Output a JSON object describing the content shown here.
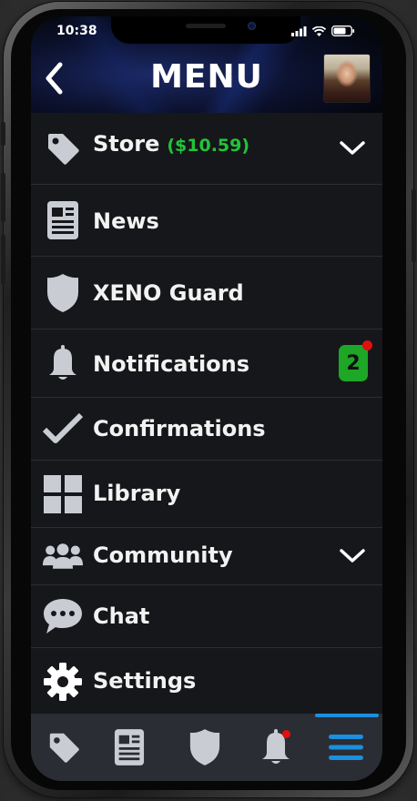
{
  "status_bar": {
    "time": "10:38"
  },
  "header": {
    "title": "MENU"
  },
  "menu": {
    "items": [
      {
        "label": "Store",
        "price": "($10.59)",
        "icon": "tag-icon",
        "expandable": true
      },
      {
        "label": "News",
        "icon": "newspaper-icon"
      },
      {
        "label": "XENO Guard",
        "icon": "shield-icon"
      },
      {
        "label": "Notifications",
        "icon": "bell-icon",
        "badge": "2"
      },
      {
        "label": "Confirmations",
        "icon": "checkmark-icon"
      },
      {
        "label": "Library",
        "icon": "grid-icon"
      },
      {
        "label": "Community",
        "icon": "people-icon",
        "expandable": true
      },
      {
        "label": "Chat",
        "icon": "chat-bubble-icon"
      },
      {
        "label": "Settings",
        "icon": "gear-icon"
      }
    ]
  },
  "tabbar": {
    "tabs": [
      {
        "name": "store",
        "icon": "tag-icon"
      },
      {
        "name": "news",
        "icon": "newspaper-icon"
      },
      {
        "name": "guard",
        "icon": "shield-icon"
      },
      {
        "name": "notifications",
        "icon": "bell-icon",
        "has_alert": true
      },
      {
        "name": "menu",
        "icon": "hamburger-icon",
        "active": true
      }
    ]
  },
  "colors": {
    "price_green": "#22c438",
    "badge_green": "#1ea627",
    "alert_red": "#e10f0f",
    "active_blue": "#1c8fde",
    "icon_gray": "#c9cdd3"
  }
}
